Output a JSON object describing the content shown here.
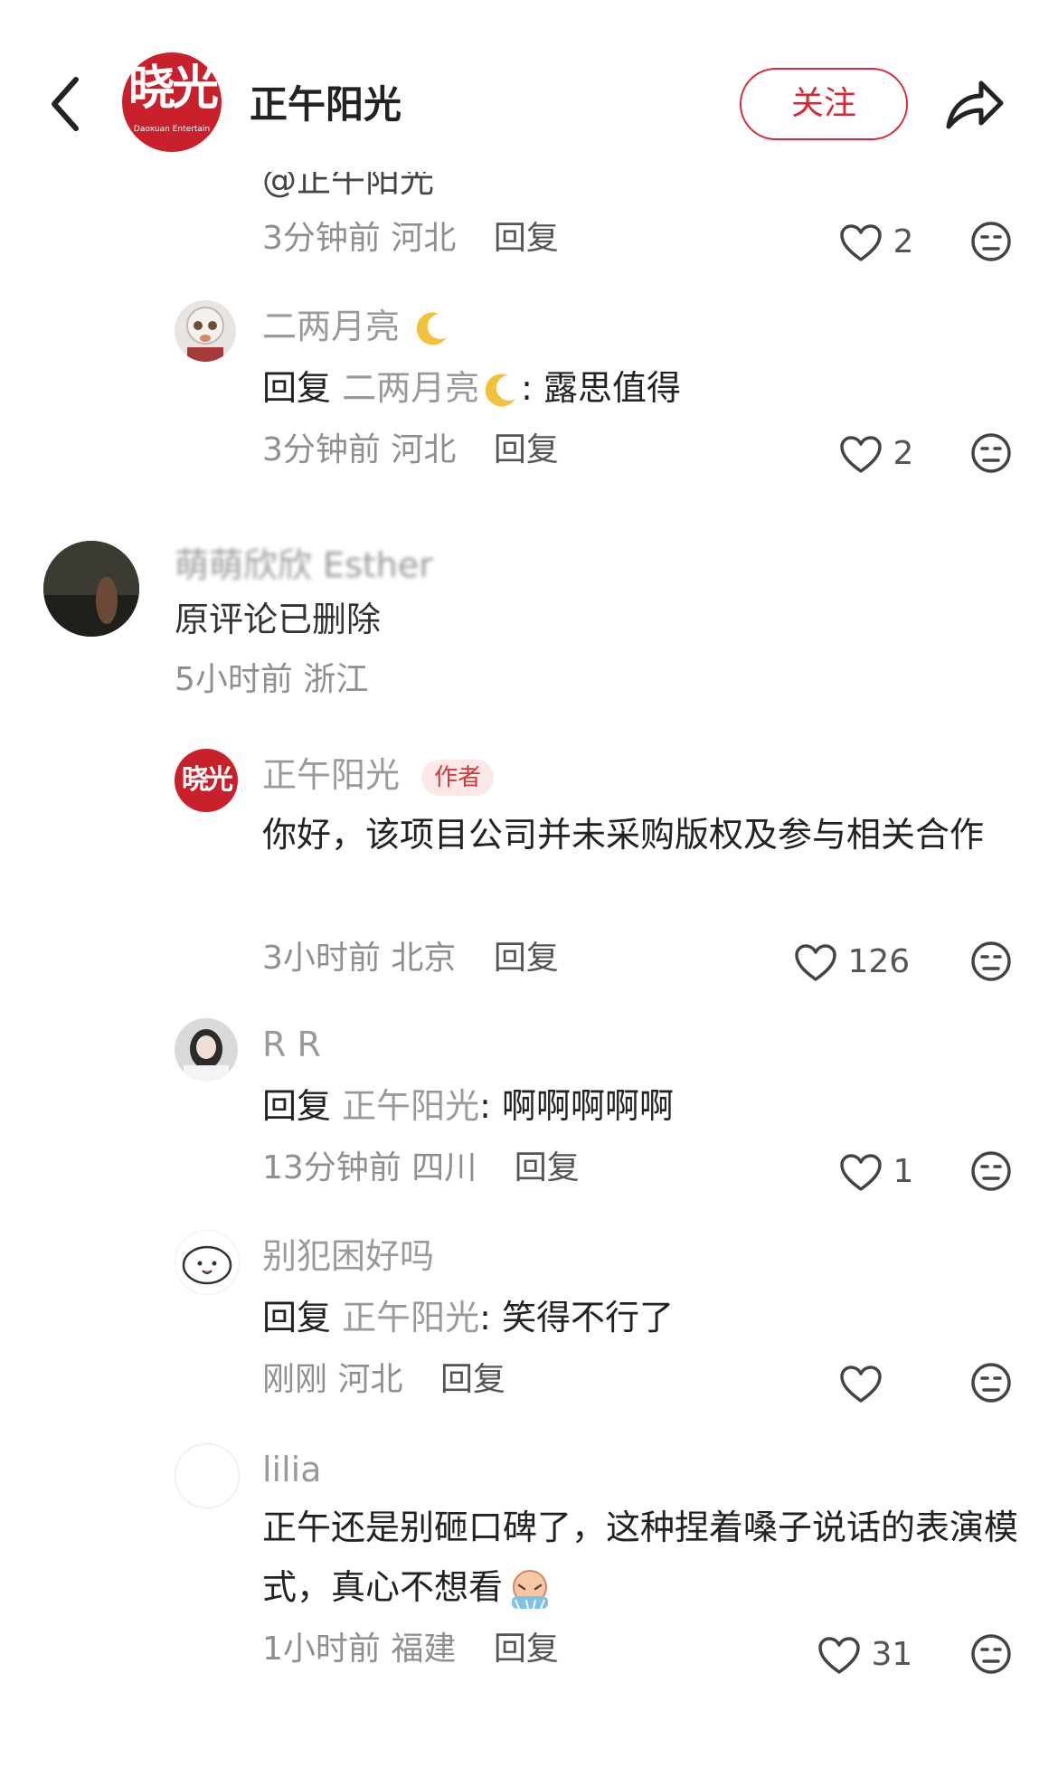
{
  "header": {
    "title": "正午阳光",
    "follow_label": "关注",
    "logo_text": "晓光",
    "logo_sub": "Daoxuan\nEntertain"
  },
  "comments": [
    {
      "partial_text": "@正午阳光",
      "time": "3分钟前",
      "location": "河北",
      "reply_label": "回复",
      "likes": "2"
    },
    {
      "name": "二两月亮",
      "reply_prefix": "回复",
      "reply_to": "二两月亮",
      "body": ": 露思值得",
      "time": "3分钟前",
      "location": "河北",
      "reply_label": "回复",
      "likes": "2"
    },
    {
      "name": "萌萌欣欣 Esther",
      "body": "原评论已删除",
      "time": "5小时前",
      "location": "浙江"
    },
    {
      "name": "正午阳光",
      "badge": "作者",
      "body": "你好，该项目公司并未采购版权及参与相关合作",
      "time": "3小时前",
      "location": "北京",
      "reply_label": "回复",
      "likes": "126"
    },
    {
      "name": "R R",
      "reply_prefix": "回复",
      "reply_to": "正午阳光",
      "body": ": 啊啊啊啊啊",
      "time": "13分钟前",
      "location": "四川",
      "reply_label": "回复",
      "likes": "1"
    },
    {
      "name": "别犯困好吗",
      "reply_prefix": "回复",
      "reply_to": "正午阳光",
      "body": ": 笑得不行了",
      "time": "刚刚",
      "location": "河北",
      "reply_label": "回复",
      "likes": ""
    },
    {
      "name": "lilia",
      "body": "正午还是别砸口碑了，这种捏着嗓子说话的表演模式，真心不想看",
      "time": "1小时前",
      "location": "福建",
      "reply_label": "回复",
      "likes": "31"
    }
  ],
  "icons": {
    "back": "chevron-left-icon",
    "share": "share-arrow-icon",
    "like": "heart-icon",
    "dislike": "unhappy-face-icon"
  },
  "colors": {
    "accent": "#d7283a",
    "logo_bg": "#c8212b",
    "muted_text": "#9a9a9a"
  }
}
